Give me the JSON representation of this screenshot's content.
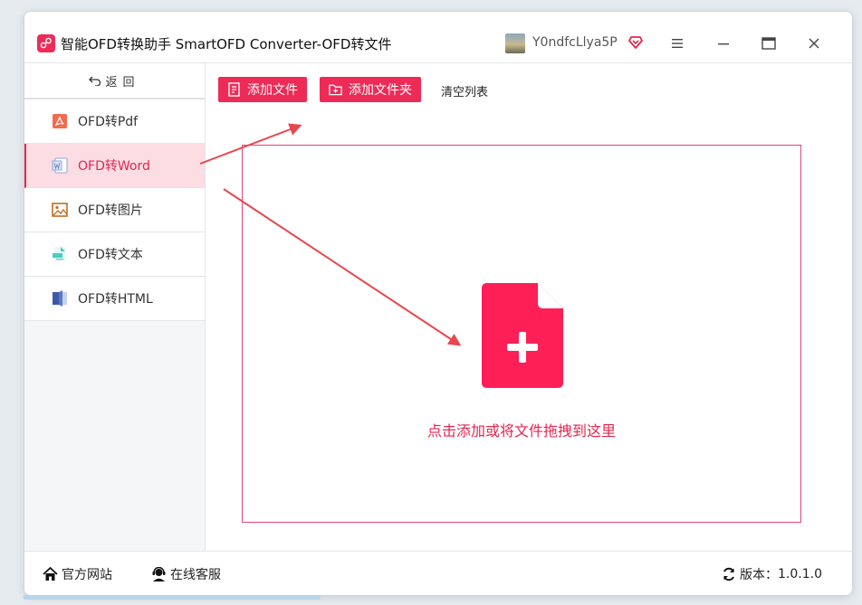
{
  "app": {
    "title": "智能OFD转换助手 SmartOFD Converter-OFD转文件",
    "username": "Y0ndfcLlya5P"
  },
  "sidebar": {
    "back_label": "返回",
    "items": [
      {
        "label": "OFD转Pdf",
        "icon": "pdf-icon"
      },
      {
        "label": "OFD转Word",
        "icon": "word-icon",
        "active": true
      },
      {
        "label": "OFD转图片",
        "icon": "image-icon"
      },
      {
        "label": "OFD转文本",
        "icon": "text-icon"
      },
      {
        "label": "OFD转HTML",
        "icon": "html-icon"
      }
    ]
  },
  "toolbar": {
    "add_file": "添加文件",
    "add_folder": "添加文件夹",
    "clear_list": "清空列表"
  },
  "dropzone": {
    "text": "点击添加或将文件拖拽到这里"
  },
  "status": {
    "website": "官方网站",
    "support": "在线客服",
    "version_label": "版本：",
    "version": "1.0.1.0"
  },
  "colors": {
    "accent": "#ee2b57",
    "active_bg": "#fbdde3",
    "arrow": "#e8474f"
  }
}
